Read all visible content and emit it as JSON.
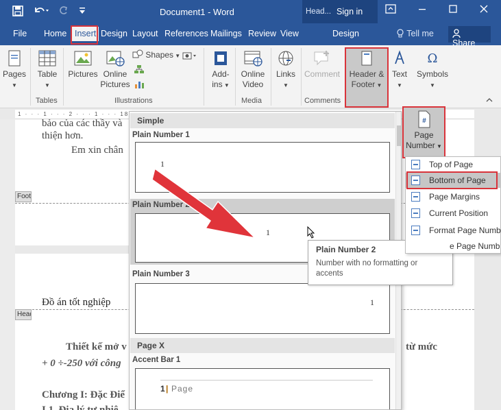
{
  "titlebar": {
    "title": "Document1 - Word",
    "contextual_label": "Head...",
    "sign_in": "Sign in",
    "icons": {
      "save": "save-icon",
      "undo": "undo-icon",
      "redo": "redo-icon",
      "customize": "customize-icon",
      "ribbon_options": "ribbon-display-icon",
      "minimize": "minimize-icon",
      "maximize": "maximize-icon",
      "close": "close-icon"
    }
  },
  "tabs": {
    "file": "File",
    "home": "Home",
    "insert": "Insert",
    "design": "Design",
    "layout": "Layout",
    "references": "References",
    "mailings": "Mailings",
    "review": "Review",
    "view": "View",
    "design_ctx": "Design",
    "tell_me": "Tell me",
    "share": "Share"
  },
  "ribbon": {
    "pages": "Pages",
    "table": "Table",
    "pictures": "Pictures",
    "online_pictures_1": "Online",
    "online_pictures_2": "Pictures",
    "shapes": "Shapes",
    "addins_1": "Add-",
    "addins_2": "ins",
    "online_video_1": "Online",
    "online_video_2": "Video",
    "links": "Links",
    "comment": "Comment",
    "header_footer_1": "Header &",
    "header_footer_2": "Footer",
    "text": "Text",
    "symbols": "Symbols",
    "groups": {
      "tables": "Tables",
      "illustrations": "Illustrations",
      "media": "Media",
      "comments": "Comments"
    }
  },
  "ruler": {
    "text": "1 · · · 1 · · · 2 · · · 1 · · · 18 · ·"
  },
  "document": {
    "line1": "bảo của các thầy và",
    "line2": "thiện hơn.",
    "line3": "Em xin chân",
    "footer_tag": "Footer",
    "header_tag": "Header",
    "heading": "Đồ án tốt nghiệp",
    "para1": "Thiết kế mở v",
    "para1_right": "từ mức",
    "para2": "+ 0 ÷-250 với công",
    "chapter": "Chương I: Đặc Điể",
    "sub": "I.1. Địa lý tự nhiê"
  },
  "gallery": {
    "simple": "Simple",
    "items": [
      {
        "title": "Plain Number 1",
        "num": "1"
      },
      {
        "title": "Plain Number 2",
        "num": "1"
      },
      {
        "title": "Plain Number 3",
        "num": "1"
      }
    ],
    "page_x": "Page X",
    "accent_bar": "Accent Bar 1",
    "accent_num": "1",
    "accent_sep": "|",
    "accent_page": "Page"
  },
  "tooltip": {
    "title": "Plain Number 2",
    "desc": "Number with no formatting or accents"
  },
  "page_number": {
    "label_1": "Page",
    "label_2": "Number"
  },
  "submenu": {
    "items": [
      "Top of Page",
      "Bottom of Page",
      "Page Margins",
      "Current Position",
      "Format Page Numbe",
      "e Page Numb"
    ]
  },
  "colors": {
    "word_blue": "#2b579a",
    "highlight_red": "#d9333a",
    "arrow_red": "#e0343a"
  }
}
